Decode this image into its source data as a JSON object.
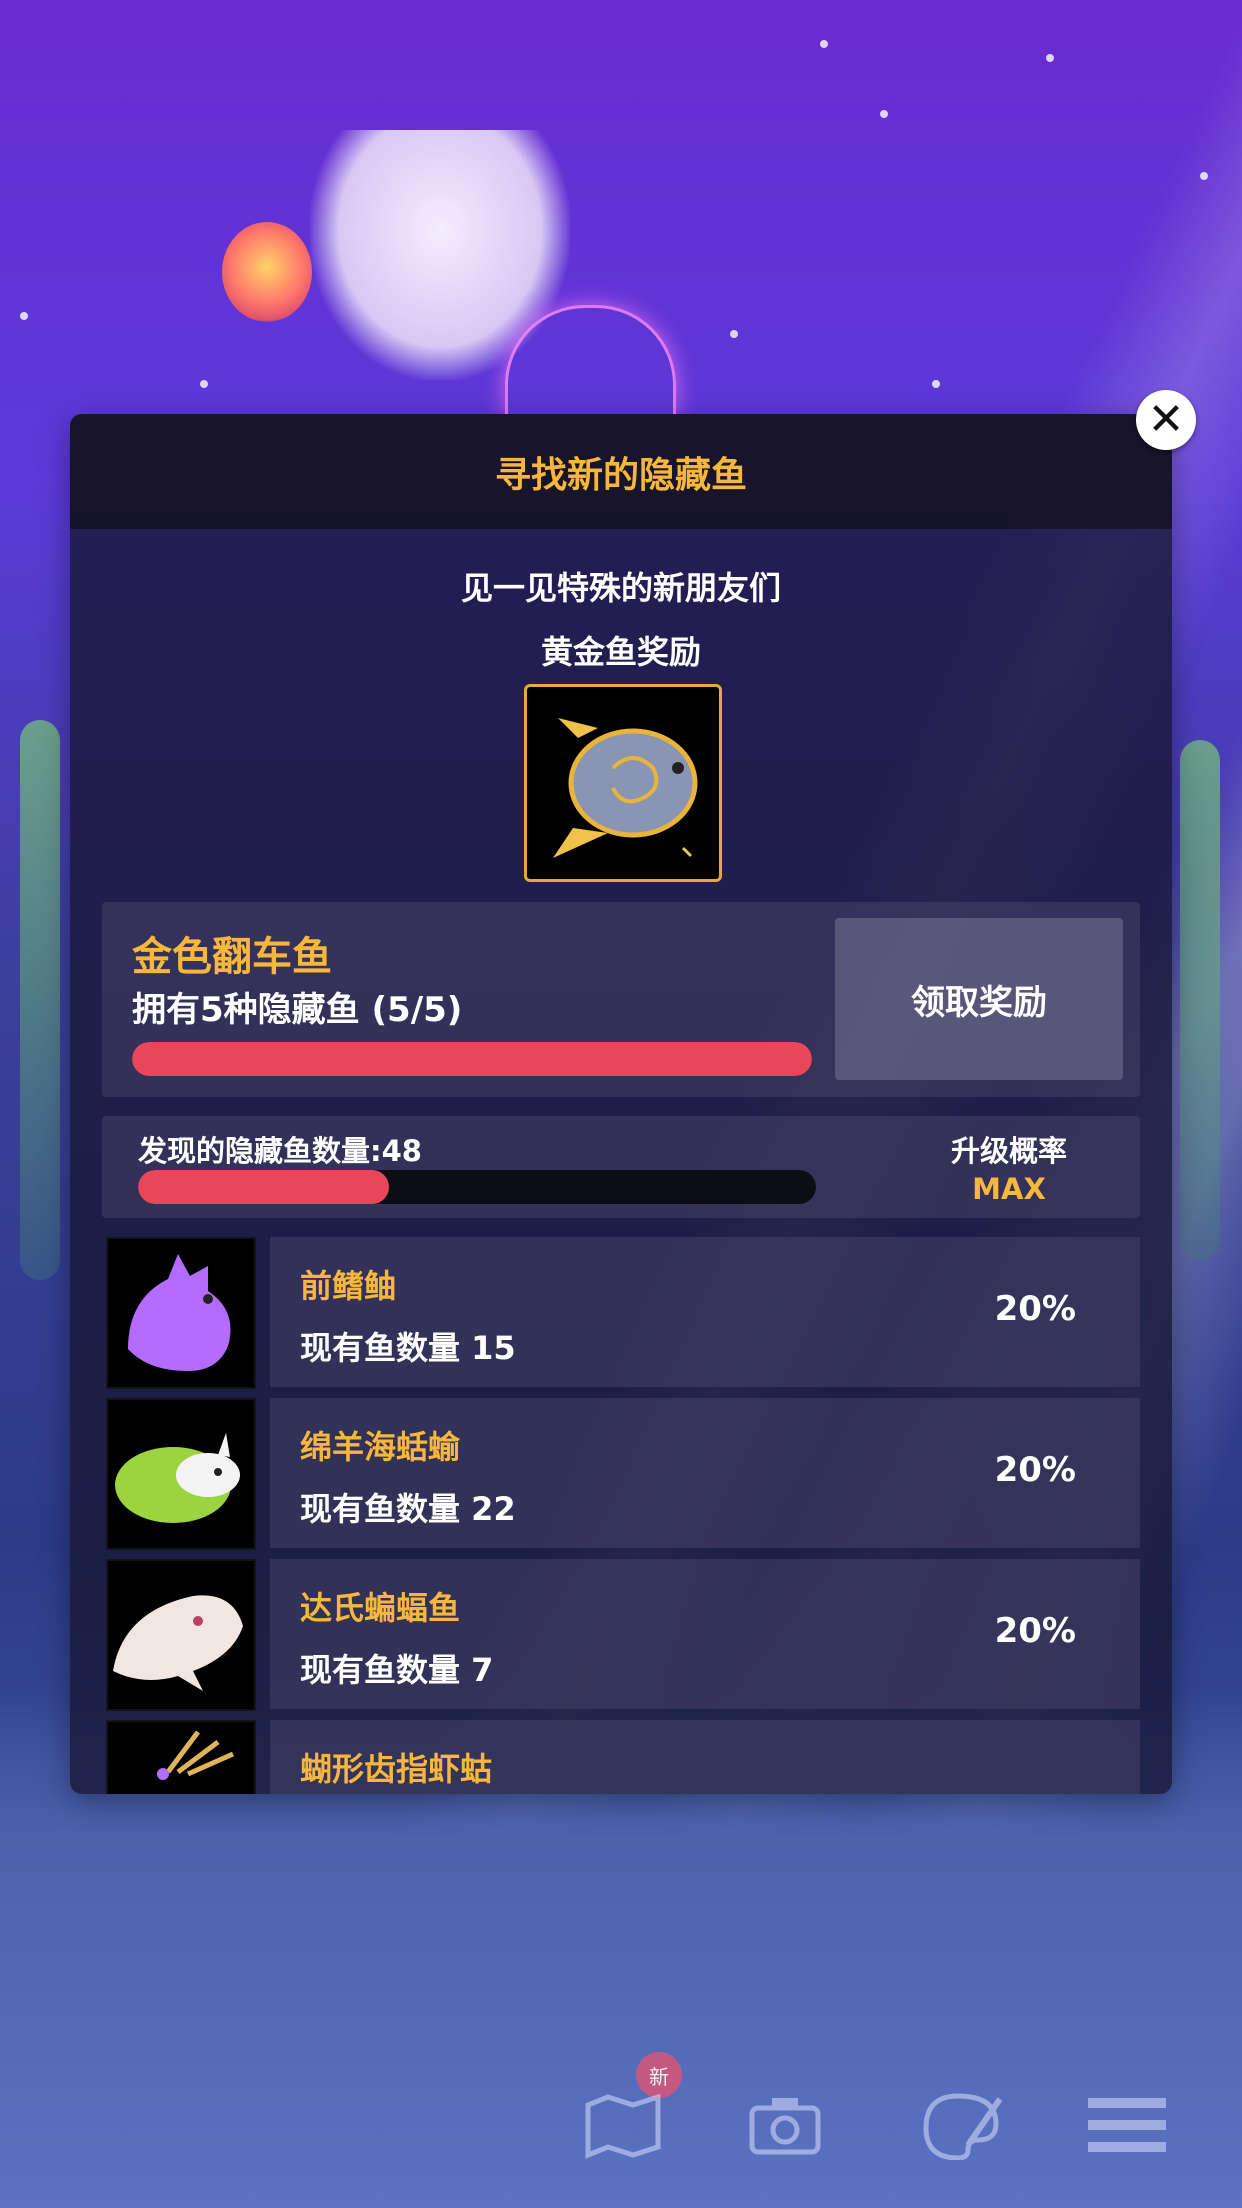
{
  "panel": {
    "title": "寻找新的隐藏鱼",
    "subtitle": "见一见特殊的新朋友们",
    "reward_caption": "黄金鱼奖励",
    "reward_icon": "golden-sunfish-icon"
  },
  "reward": {
    "name": "金色翻车鱼",
    "description": "拥有5种隐藏鱼 (5/5)",
    "progress": 1.0,
    "claim_label": "领取奖励"
  },
  "discovered": {
    "label": "发现的隐藏鱼数量:48",
    "progress": 0.37,
    "upgrade_rate_label": "升级概率",
    "upgrade_rate_value": "MAX"
  },
  "fish": [
    {
      "name": "前鳍鲉",
      "count": "现有鱼数量 15",
      "rate": "20%",
      "icon": "purple-fish-icon",
      "color": "#b46cff"
    },
    {
      "name": "绵羊海蛞蝓",
      "count": "现有鱼数量 22",
      "rate": "20%",
      "icon": "sea-slug-icon",
      "color": "#9bd43e"
    },
    {
      "name": "达氏蝙蝠鱼",
      "count": "现有鱼数量 7",
      "rate": "20%",
      "icon": "batfish-icon",
      "color": "#f2e6e0"
    },
    {
      "name": "蝴形齿指虾蛄",
      "count": "",
      "rate": "",
      "icon": "mantis-shrimp-icon",
      "color": "#e2b45a"
    }
  ],
  "toolbar": {
    "new_badge": "新",
    "items": [
      "map-icon",
      "camera-icon",
      "palette-icon",
      "list-icon"
    ]
  },
  "colors": {
    "accent": "#f6b73c",
    "progress": "#e8475a"
  }
}
